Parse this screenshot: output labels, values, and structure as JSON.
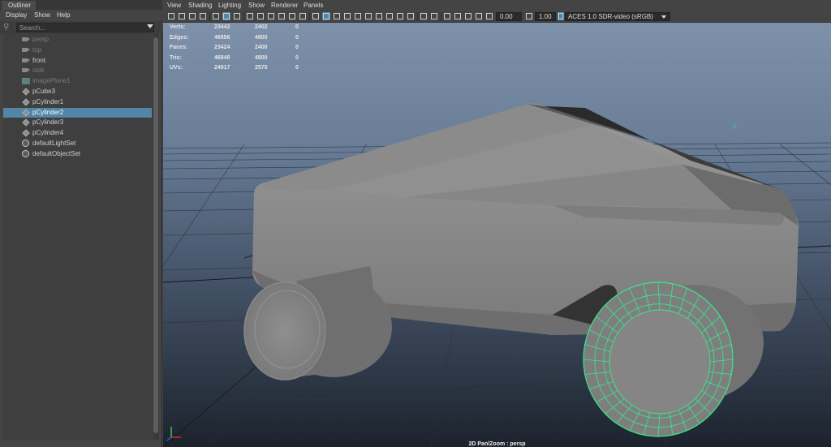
{
  "outliner": {
    "tab_label": "Outliner",
    "menu": [
      "Display",
      "Show",
      "Help"
    ],
    "search_placeholder": "Search...",
    "items": [
      {
        "label": "persp",
        "icon": "camera-icon",
        "dim": true,
        "selected": false
      },
      {
        "label": "top",
        "icon": "camera-icon",
        "dim": true,
        "selected": false
      },
      {
        "label": "front",
        "icon": "camera-icon",
        "dim": false,
        "selected": false
      },
      {
        "label": "side",
        "icon": "camera-icon",
        "dim": true,
        "selected": false
      },
      {
        "label": "imagePlane1",
        "icon": "image-plane-icon",
        "dim": true,
        "selected": false
      },
      {
        "label": "pCube3",
        "icon": "mesh-icon",
        "dim": false,
        "selected": false
      },
      {
        "label": "pCylinder1",
        "icon": "mesh-icon",
        "dim": false,
        "selected": false
      },
      {
        "label": "pCylinder2",
        "icon": "mesh-icon",
        "dim": false,
        "selected": true
      },
      {
        "label": "pCylinder3",
        "icon": "mesh-icon",
        "dim": false,
        "selected": false
      },
      {
        "label": "pCylinder4",
        "icon": "mesh-icon",
        "dim": false,
        "selected": false
      },
      {
        "label": "defaultLightSet",
        "icon": "set-icon",
        "dim": false,
        "selected": false
      },
      {
        "label": "defaultObjectSet",
        "icon": "set-icon",
        "dim": false,
        "selected": false
      }
    ]
  },
  "viewport": {
    "menu": [
      "View",
      "Shading",
      "Lighting",
      "Show",
      "Renderer",
      "Panels"
    ],
    "exposure_value": "0.00",
    "gamma_value": "1.00",
    "color_space": "ACES 1.0 SDR-video (sRGB)",
    "camera_label": "2D Pan/Zoom : persp",
    "hud": [
      {
        "label": "Verts:",
        "a": "23442",
        "b": "2402",
        "c": "0"
      },
      {
        "label": "Edges:",
        "a": "46856",
        "b": "4800",
        "c": "0"
      },
      {
        "label": "Faces:",
        "a": "23424",
        "b": "2400",
        "c": "0"
      },
      {
        "label": "Tris:",
        "a": "46848",
        "b": "4800",
        "c": "0"
      },
      {
        "label": "UVs:",
        "a": "24917",
        "b": "2575",
        "c": "0"
      }
    ]
  },
  "colors": {
    "selection": "#5285a6",
    "wireframe_highlight": "#4dff9a",
    "sky_top": "#7c8fa9",
    "sky_bottom": "#1e2631"
  }
}
